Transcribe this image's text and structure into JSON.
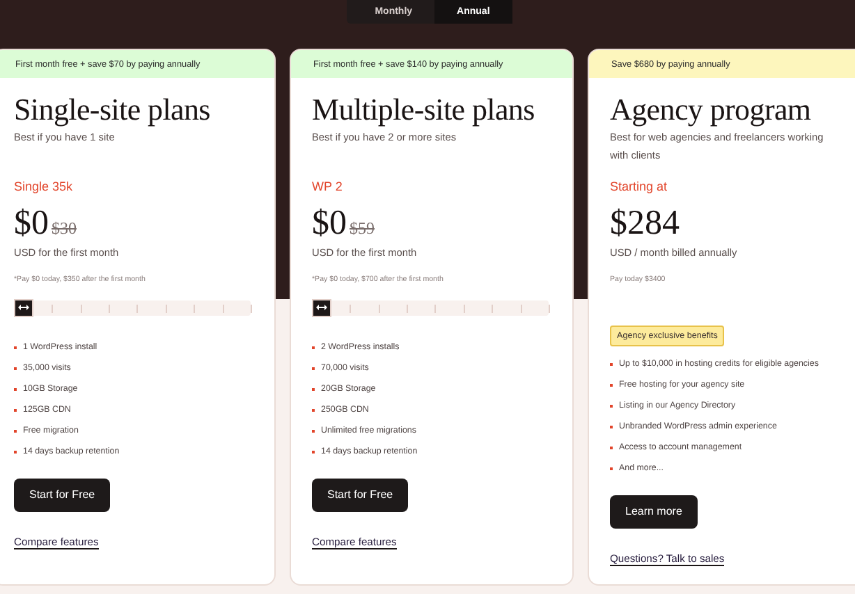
{
  "billing_toggle": [
    {
      "label": "Monthly",
      "selected": false
    },
    {
      "label": "Annual",
      "selected": true
    }
  ],
  "plans": [
    {
      "kind": "slider",
      "color": "#dcfcd6",
      "banner": "First month free + save $70 by paying annually",
      "title": "Single-site plans",
      "subtitle": "Best if you have 1 site",
      "tier": "Single 35k",
      "price": "$0",
      "old_price": "$30",
      "price_note": "USD for the first month",
      "footnote": "*Pay $0 today, $350 after the first month",
      "slider": {
        "level": 0
      },
      "features": [
        "1 WordPress install",
        "35,000 visits",
        "10GB Storage",
        "125GB CDN",
        "Free migration",
        "14 days backup retention"
      ],
      "button": "Start for Free",
      "link": "Compare features"
    },
    {
      "kind": "slider",
      "color": "#dcfcd6",
      "banner": "First month free + save $140 by paying annually",
      "title": "Multiple-site plans",
      "subtitle": "Best if you have 2 or more sites",
      "tier": "WP 2",
      "price": "$0",
      "old_price": "$59",
      "price_note": "USD for the first month",
      "footnote": "*Pay $0 today, $700 after the first month",
      "slider": {
        "level": 0
      },
      "features": [
        "2 WordPress installs",
        "70,000 visits",
        "20GB Storage",
        "250GB CDN",
        "Unlimited free migrations",
        "14 days backup retention"
      ],
      "button": "Start for Free",
      "link": "Compare features"
    },
    {
      "kind": "agency",
      "color": "#fdf6bd",
      "banner": "Save $680 by paying annually",
      "title": "Agency program",
      "subtitle": "Best for web agencies and freelancers working with clients",
      "tier": "Starting at",
      "price": "$284",
      "price_note": "USD / month billed annually",
      "footnote": "Pay today $3400",
      "badge": "Agency exclusive benefits",
      "features": [
        "Up to $10,000 in hosting credits for eligible agencies",
        "Free hosting for your agency site",
        "Listing in our Agency Directory",
        "Unbranded WordPress admin experience",
        "Access to account management",
        "And more..."
      ],
      "button": "Learn more",
      "link": "Questions? Talk to sales"
    }
  ]
}
